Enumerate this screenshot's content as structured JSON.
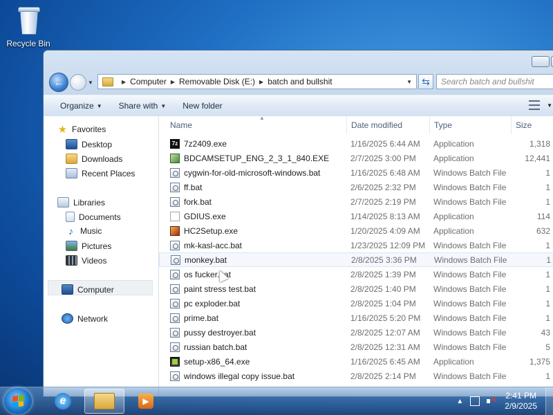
{
  "desktop": {
    "recycle_bin_label": "Recycle Bin"
  },
  "address": {
    "crumbs": [
      "Computer",
      "Removable Disk (E:)",
      "batch and bullshit"
    ],
    "search_placeholder": "Search batch and bullshit"
  },
  "toolbar": {
    "organize": "Organize",
    "share_with": "Share with",
    "new_folder": "New folder"
  },
  "nav": {
    "favorites": "Favorites",
    "desktop": "Desktop",
    "downloads": "Downloads",
    "recent_places": "Recent Places",
    "libraries": "Libraries",
    "documents": "Documents",
    "music": "Music",
    "pictures": "Pictures",
    "videos": "Videos",
    "computer": "Computer",
    "network": "Network"
  },
  "columns": {
    "name": "Name",
    "date_modified": "Date modified",
    "type": "Type",
    "size": "Size"
  },
  "files": [
    {
      "name": "7z2409.exe",
      "date": "1/16/2025 6:44 AM",
      "type": "Application",
      "size": "1,318",
      "icon": "7z-icon"
    },
    {
      "name": "BDCAMSETUP_ENG_2_3_1_840.EXE",
      "date": "2/7/2025 3:00 PM",
      "type": "Application",
      "size": "12,441",
      "icon": "installer-icon"
    },
    {
      "name": "cygwin-for-old-microsoft-windows.bat",
      "date": "1/16/2025 6:48 AM",
      "type": "Windows Batch File",
      "size": "1",
      "icon": "batch-file-icon"
    },
    {
      "name": "ff.bat",
      "date": "2/6/2025 2:32 PM",
      "type": "Windows Batch File",
      "size": "1",
      "icon": "batch-file-icon"
    },
    {
      "name": "fork.bat",
      "date": "2/7/2025 2:19 PM",
      "type": "Windows Batch File",
      "size": "1",
      "icon": "batch-file-icon"
    },
    {
      "name": "GDIUS.exe",
      "date": "1/14/2025 8:13 AM",
      "type": "Application",
      "size": "114",
      "icon": "generic-exe-icon"
    },
    {
      "name": "HC2Setup.exe",
      "date": "1/20/2025 4:09 AM",
      "type": "Application",
      "size": "632",
      "icon": "hc2-setup-icon"
    },
    {
      "name": "mk-kasl-acc.bat",
      "date": "1/23/2025 12:09 PM",
      "type": "Windows Batch File",
      "size": "1",
      "icon": "batch-file-icon"
    },
    {
      "name": "monkey.bat",
      "date": "2/8/2025 3:36 PM",
      "type": "Windows Batch File",
      "size": "1",
      "icon": "batch-file-icon"
    },
    {
      "name": "os fucker.bat",
      "date": "2/8/2025 1:39 PM",
      "type": "Windows Batch File",
      "size": "1",
      "icon": "batch-file-icon"
    },
    {
      "name": "paint stress test.bat",
      "date": "2/8/2025 1:40 PM",
      "type": "Windows Batch File",
      "size": "1",
      "icon": "batch-file-icon"
    },
    {
      "name": "pc exploder.bat",
      "date": "2/8/2025 1:04 PM",
      "type": "Windows Batch File",
      "size": "1",
      "icon": "batch-file-icon"
    },
    {
      "name": "prime.bat",
      "date": "1/16/2025 5:20 PM",
      "type": "Windows Batch File",
      "size": "1",
      "icon": "batch-file-icon"
    },
    {
      "name": "pussy destroyer.bat",
      "date": "2/8/2025 12:07 AM",
      "type": "Windows Batch File",
      "size": "43",
      "icon": "batch-file-icon"
    },
    {
      "name": "russian batch.bat",
      "date": "2/8/2025 12:31 AM",
      "type": "Windows Batch File",
      "size": "5",
      "icon": "batch-file-icon"
    },
    {
      "name": "setup-x86_64.exe",
      "date": "1/16/2025 6:45 AM",
      "type": "Application",
      "size": "1,375",
      "icon": "cygwin-setup-icon"
    },
    {
      "name": "windows illegal copy issue.bat",
      "date": "2/8/2025 2:14 PM",
      "type": "Windows Batch File",
      "size": "1",
      "icon": "batch-file-icon"
    }
  ],
  "taskbar": {
    "time": "2:41 PM",
    "date": "2/9/2025"
  }
}
